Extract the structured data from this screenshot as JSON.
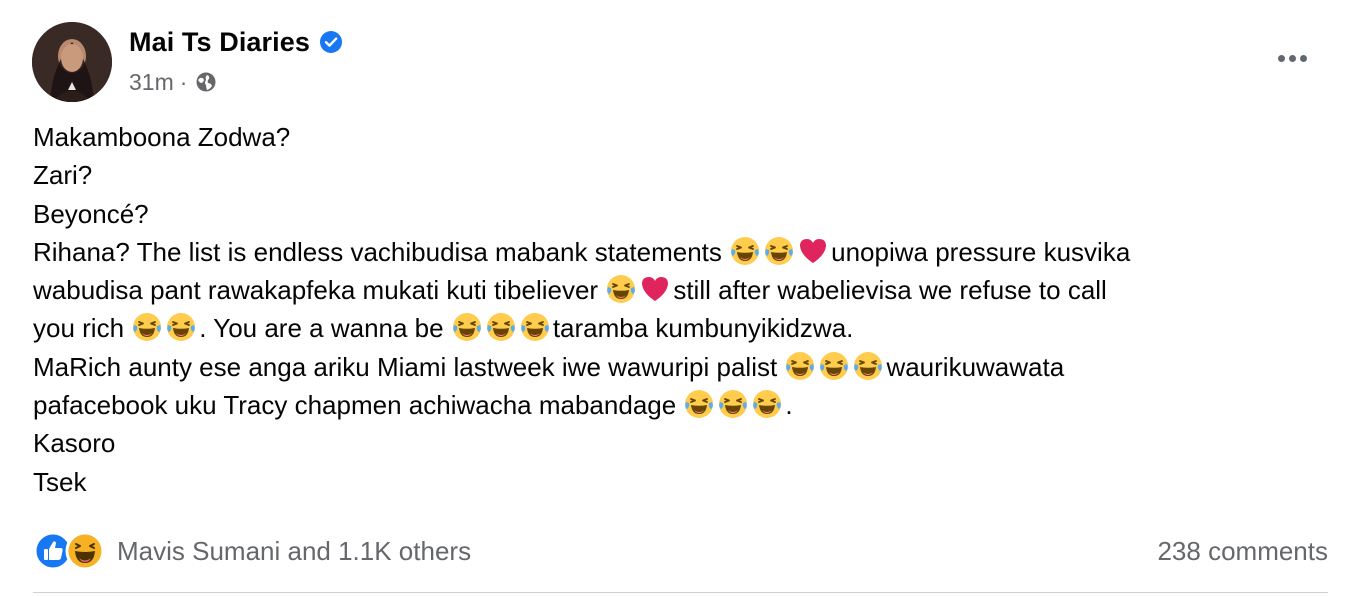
{
  "post": {
    "author": "Mai Ts Diaries",
    "time": "31m",
    "separator": "·",
    "verified_icon": "verified-badge-icon",
    "privacy_icon": "globe-icon",
    "more_icon": "more-options-icon",
    "lines": [
      [
        "Makamboona Zodwa?"
      ],
      [
        "Zari?"
      ],
      [
        "Beyoncé?"
      ],
      [
        "Rihana? The list is endless vachibudisa mabank statements ",
        "laugh",
        "laugh",
        "heart",
        "unopiwa pressure kusvika"
      ],
      [
        "wabudisa pant rawakapfeka mukati kuti tibeliever ",
        "laugh",
        "heart",
        "still after wabelievisa we refuse to call"
      ],
      [
        "you rich ",
        "laugh",
        "laugh",
        ". You are a wanna be ",
        "laugh",
        "laugh",
        "laugh",
        "taramba kumbunyikidzwa."
      ],
      [
        "MaRich aunty ese anga ariku Miami lastweek iwe wawuripi palist ",
        "laugh",
        "laugh",
        "laugh",
        "waurikuwawata"
      ],
      [
        "pafacebook uku Tracy chapmen achiwacha mabandage ",
        "laugh",
        "laugh",
        "laugh",
        "."
      ],
      [
        "Kasoro"
      ],
      [
        "Tsek"
      ]
    ],
    "reactions": {
      "icons": [
        "like-icon",
        "haha-icon"
      ],
      "text": "Mavis Sumani and 1.1K others"
    },
    "comments": "238 comments"
  },
  "colors": {
    "text": "#050505",
    "secondary": "#65676b",
    "verified": "#1877f2",
    "like": "#1877f2",
    "haha": "#f7b125",
    "heart": "#e0245e"
  }
}
